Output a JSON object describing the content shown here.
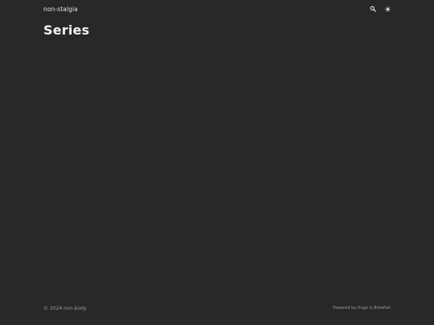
{
  "header": {
    "site_title": "non-stalgia",
    "search_icon": "search-icon",
    "theme_icon": "theme-toggle-icon"
  },
  "main": {
    "page_title": "Series"
  },
  "footer": {
    "copyright": "© 2024 non-body",
    "powered_prefix": "Powered by",
    "hugo_link": "Hugo",
    "separator": "&",
    "blowfish_link": "Blowfish"
  },
  "colors": {
    "background": "#28282a",
    "text": "#f2f2f2",
    "muted": "#9b9b9e"
  }
}
